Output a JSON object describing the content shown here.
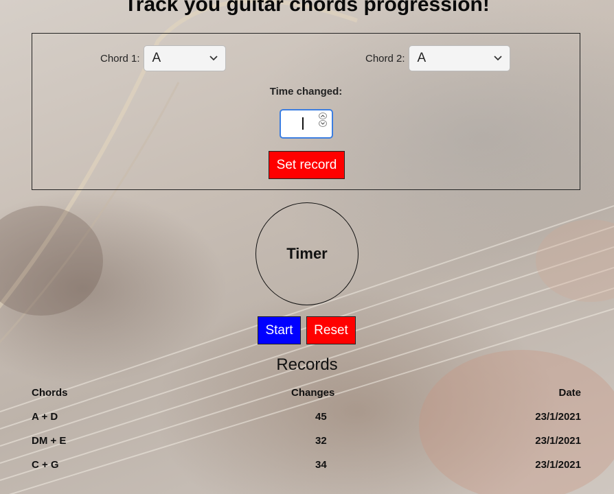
{
  "title": "Track you guitar chords progression!",
  "form": {
    "chord1_label": "Chord 1:",
    "chord1_value": "A",
    "chord2_label": "Chord 2:",
    "chord2_value": "A",
    "time_label": "Time changed:",
    "time_value": "",
    "set_record_label": "Set record"
  },
  "timer": {
    "label": "Timer"
  },
  "controls": {
    "start_label": "Start",
    "reset_label": "Reset"
  },
  "records": {
    "title": "Records",
    "columns": [
      "Chords",
      "Changes",
      "Date"
    ],
    "rows": [
      {
        "chords": "A + D",
        "changes": "45",
        "date": "23/1/2021"
      },
      {
        "chords": "DM + E",
        "changes": "32",
        "date": "23/1/2021"
      },
      {
        "chords": "C + G",
        "changes": "34",
        "date": "23/1/2021"
      }
    ]
  },
  "colors": {
    "primary_red": "#ff0000",
    "primary_blue": "#0000ff",
    "focus_blue": "#3b7de0"
  },
  "icons": {
    "select_arrow": "chevron-down-icon",
    "spin_up": "chevron-up-icon",
    "spin_down": "chevron-down-icon"
  }
}
